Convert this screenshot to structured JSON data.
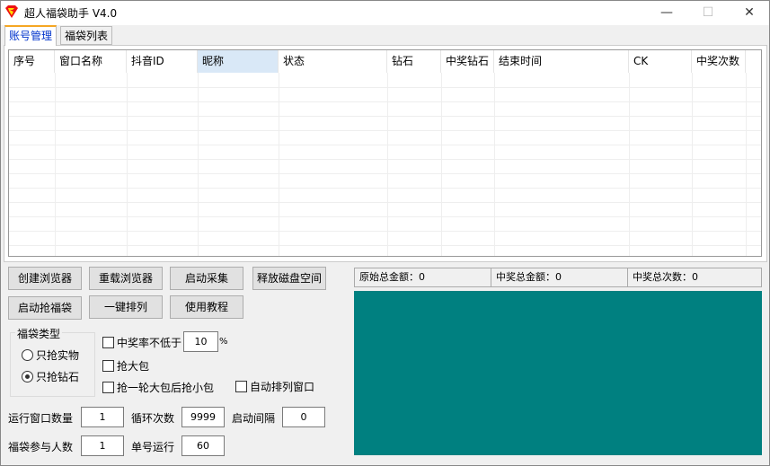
{
  "window": {
    "title": "超人福袋助手 V4.0",
    "minimize": "—",
    "maximize": "☐",
    "close": "✕"
  },
  "tabs": [
    {
      "label": "账号管理",
      "active": true
    },
    {
      "label": "福袋列表",
      "active": false
    }
  ],
  "table": {
    "columns": [
      "序号",
      "窗口名称",
      "抖音ID",
      "昵称",
      "状态",
      "钻石",
      "中奖钻石",
      "结束时间",
      "CK",
      "中奖次数"
    ],
    "rows": []
  },
  "buttons": {
    "create_browser": "创建浏览器",
    "reload_browser": "重载浏览器",
    "start_collect": "启动采集",
    "free_disk": "释放磁盘空间",
    "start_grab": "启动抢福袋",
    "arrange": "一键排列",
    "tutorial": "使用教程"
  },
  "bag_type": {
    "label": "福袋类型",
    "options": [
      {
        "label": "只抢实物",
        "selected": false
      },
      {
        "label": "只抢钻石",
        "selected": true
      }
    ]
  },
  "options": {
    "win_rate_label": "中奖率不低于",
    "win_rate_checked": false,
    "win_rate_value": "10",
    "win_rate_unit": "%",
    "big_bag": "抢大包",
    "big_bag_checked": false,
    "big_then_small": "抢一轮大包后抢小包",
    "big_then_small_checked": false,
    "auto_arrange": "自动排列窗口",
    "auto_arrange_checked": false
  },
  "fields": {
    "window_count_label": "运行窗口数量",
    "window_count": "1",
    "loop_label": "循环次数",
    "loop": "9999",
    "interval_label": "启动间隔",
    "interval": "0",
    "participants_label": "福袋参与人数",
    "participants": "1",
    "single_run_label": "单号运行",
    "single_run": "60"
  },
  "stats": {
    "original_total": "原始总金额：0",
    "win_total": "中奖总金额：0",
    "win_count": "中奖总次数：0"
  },
  "colors": {
    "log_panel": "#008080",
    "active_tab": "#0033cc",
    "selected_header": "#d9e8f7"
  }
}
